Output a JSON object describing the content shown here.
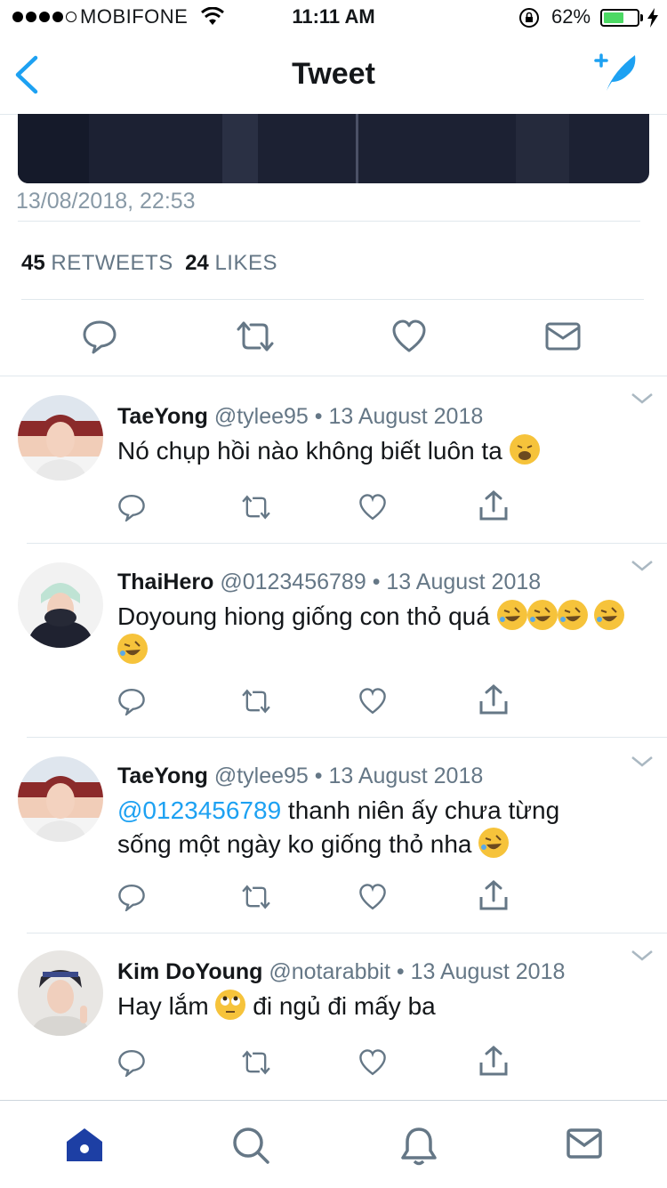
{
  "status_bar": {
    "carrier": "MOBIFONE",
    "time": "11:11 AM",
    "battery_percent": "62%",
    "battery_level": 0.62,
    "battery_color": "#4cd964"
  },
  "nav": {
    "title": "Tweet",
    "back_icon": "chevron-left-icon",
    "compose_icon": "compose-tweet-icon",
    "accent": "#1da1f2"
  },
  "tweet": {
    "timestamp": "13/08/2018, 22:53",
    "retweets_count": "45",
    "retweets_label": "RETWEETS",
    "likes_count": "24",
    "likes_label": "LIKES",
    "actions": [
      "reply-icon",
      "retweet-icon",
      "like-icon",
      "message-icon"
    ]
  },
  "replies": [
    {
      "name": "TaeYong",
      "handle": "@tylee95",
      "sep": "•",
      "date": "13 August 2018",
      "text": "Nó chụp hồi nào không biết luôn ta",
      "emoji": [
        "weary-face-emoji"
      ]
    },
    {
      "name": "ThaiHero",
      "handle": "@0123456789",
      "sep": "•",
      "date": "13 August 2018",
      "text": "Doyoung hiong giống con thỏ quá",
      "emoji": [
        "rofl-emoji",
        "rofl-emoji",
        "rofl-emoji",
        "rofl-emoji",
        "rofl-emoji"
      ]
    },
    {
      "name": "TaeYong",
      "handle": "@tylee95",
      "sep": "•",
      "date": "13 August 2018",
      "mention": "@0123456789",
      "text_line1": " thanh niên ấy chưa từng",
      "text_line2": "sống một ngày ko giống thỏ nha",
      "emoji": [
        "rofl-emoji"
      ]
    },
    {
      "name": "Kim DoYoung",
      "handle": "@notarabbit",
      "sep": "•",
      "date": "13 August 2018",
      "text_before": "Hay lắm",
      "text_after": " đi ngủ đi mấy ba",
      "emoji": [
        "eye-roll-emoji"
      ]
    }
  ],
  "tab_bar": {
    "items": [
      "home-icon",
      "search-icon",
      "notifications-icon",
      "messages-icon"
    ],
    "active": "home-icon",
    "active_color": "#1d3fa4"
  }
}
